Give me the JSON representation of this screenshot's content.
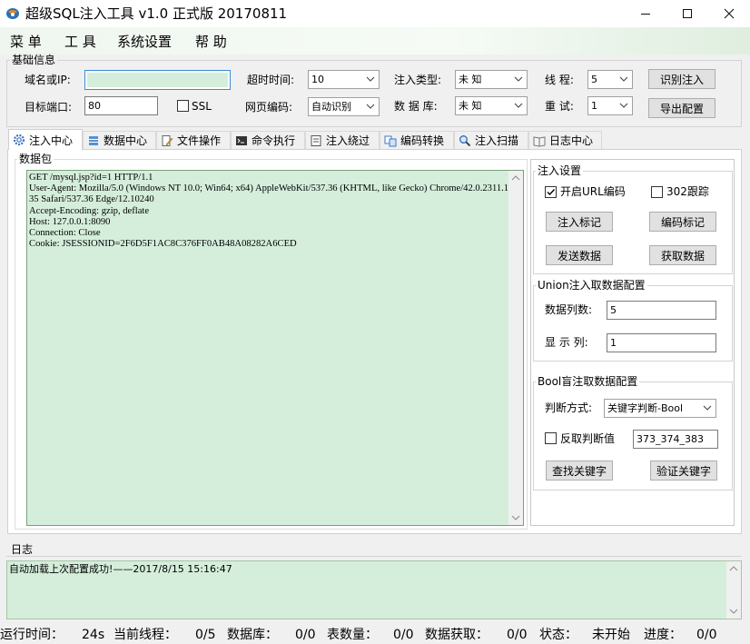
{
  "window": {
    "title": "超级SQL注入工具 v1.0 正式版 20170811"
  },
  "menu": [
    {
      "label": "菜 单"
    },
    {
      "label": "工 具"
    },
    {
      "label": "系统设置"
    },
    {
      "label": "帮 助"
    }
  ],
  "basic": {
    "title": "基础信息",
    "host_label": "域名或IP:",
    "host_value": "",
    "port_label": "目标端口:",
    "port_value": "80",
    "ssl_label": "SSL",
    "ssl_checked": false,
    "timeout_label": "超时时间:",
    "timeout_value": "10",
    "encoding_label": "网页编码:",
    "encoding_value": "自动识别",
    "inject_type_label": "注入类型:",
    "inject_type_value": "未 知",
    "db_label": "数 据 库:",
    "db_value": "未 知",
    "threads_label": "线 程:",
    "threads_value": "5",
    "retry_label": "重 试:",
    "retry_value": "1",
    "identify_button": "识别注入",
    "export_button": "导出配置"
  },
  "tabs": [
    {
      "label": "注入中心",
      "icon": "gear-icon",
      "active": true
    },
    {
      "label": "数据中心",
      "icon": "database-icon",
      "active": false
    },
    {
      "label": "文件操作",
      "icon": "file-edit-icon",
      "active": false
    },
    {
      "label": "命令执行",
      "icon": "terminal-icon",
      "active": false
    },
    {
      "label": "注入绕过",
      "icon": "bypass-icon",
      "active": false
    },
    {
      "label": "编码转换",
      "icon": "convert-icon",
      "active": false
    },
    {
      "label": "注入扫描",
      "icon": "magnifier-icon",
      "active": false
    },
    {
      "label": "日志中心",
      "icon": "book-icon",
      "active": false
    }
  ],
  "packet": {
    "title": "数据包",
    "content": "GET /mysql.jsp?id=1 HTTP/1.1\nUser-Agent: Mozilla/5.0 (Windows NT 10.0; Win64; x64) AppleWebKit/537.36 (KHTML, like Gecko) Chrome/42.0.2311.135 Safari/537.36 Edge/12.10240\nAccept-Encoding: gzip, deflate\nHost: 127.0.0.1:8090\nConnection: Close\nCookie: JSESSIONID=2F6D5F1AC8C376FF0AB48A08282A6CED"
  },
  "inject_settings": {
    "title": "注入设置",
    "url_encode_label": "开启URL编码",
    "url_encode_checked": true,
    "follow_302_label": "302跟踪",
    "follow_302_checked": false,
    "mark_button": "注入标记",
    "encode_mark_button": "编码标记",
    "send_button": "发送数据",
    "fetch_button": "获取数据"
  },
  "union": {
    "title": "Union注入取数据配置",
    "columns_label": "数据列数:",
    "columns_value": "5",
    "display_label": "显 示 列:",
    "display_value": "1"
  },
  "bool": {
    "title": "Bool盲注取数据配置",
    "method_label": "判断方式:",
    "method_value": "关键字判断-Bool",
    "invert_label": "反取判断值",
    "invert_checked": false,
    "keyword_value": "373_374_383",
    "find_button": "查找关键字",
    "verify_button": "验证关键字"
  },
  "log": {
    "title": "日志",
    "message": "自动加载上次配置成功!——2017/8/15 15:16:47"
  },
  "status": {
    "runtime_label": "运行时间：",
    "runtime_value": "24s",
    "threads_label": "当前线程：",
    "threads_value": "0/5",
    "db_label": "数据库：",
    "db_value": "0/0",
    "tables_label": "表数量：",
    "tables_value": "0/0",
    "fetch_label": "数据获取：",
    "fetch_value": "0/0",
    "state_label": "状态：",
    "state_value": "未开始",
    "progress_label": "进度：",
    "progress_value": "0/0"
  }
}
